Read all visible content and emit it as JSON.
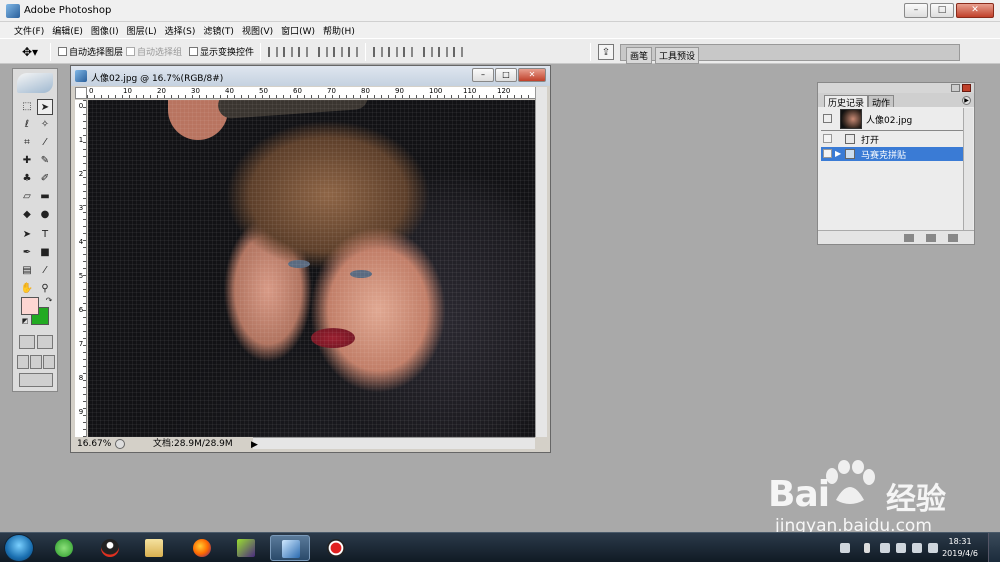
{
  "app": {
    "title": "Adobe Photoshop"
  },
  "window_controls": {
    "minimize": "–",
    "maximize": "□",
    "close": "✕"
  },
  "menu": [
    "文件(F)",
    "编辑(E)",
    "图像(I)",
    "图层(L)",
    "选择(S)",
    "滤镜(T)",
    "视图(V)",
    "窗口(W)",
    "帮助(H)"
  ],
  "options": {
    "auto_select_layer": "自动选择图层",
    "auto_select_group": "自动选择组",
    "show_transform": "显示变换控件"
  },
  "palette_well": {
    "tab1": "画笔",
    "tab2": "工具预设"
  },
  "document": {
    "title": "人像02.jpg @ 16.7%(RGB/8#)",
    "zoom": "16.67%",
    "doc_size": "文档:28.9M/28.9M",
    "ruler_ticks": [
      "0",
      "10",
      "20",
      "30",
      "40",
      "50",
      "60",
      "70",
      "80",
      "90",
      "100",
      "110",
      "120"
    ],
    "vruler_ticks": [
      "0",
      "1",
      "2",
      "3",
      "4",
      "5",
      "6",
      "7",
      "8",
      "9"
    ]
  },
  "history": {
    "tab_history": "历史记录",
    "tab_actions": "动作",
    "snapshot": "人像02.jpg",
    "steps": [
      "打开",
      "马赛克拼贴"
    ]
  },
  "colors": {
    "foreground": "#fdd6d2",
    "background": "#22aa22",
    "selection": "#3a7bd5"
  },
  "watermark": {
    "brand": "Bai",
    "brand2": "经验",
    "url": "jingyan.baidu.com"
  },
  "taskbar": {
    "time": "18:31",
    "date": "2019/4/6"
  }
}
